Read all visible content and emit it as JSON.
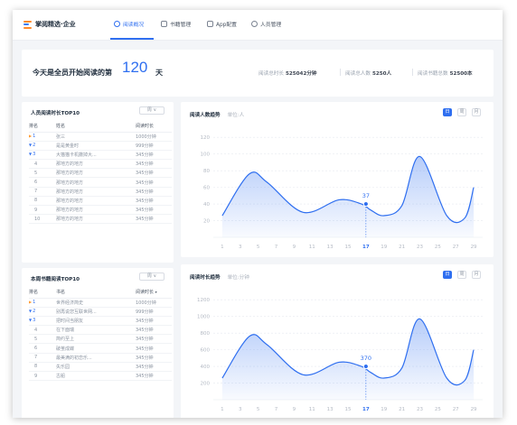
{
  "app": {
    "name": "掌阅精选·企业"
  },
  "nav": {
    "tabs": [
      {
        "label": "阅读概况"
      },
      {
        "label": "书籍管理"
      },
      {
        "label": "App配置"
      },
      {
        "label": "人员管理"
      }
    ]
  },
  "banner": {
    "lead": "今天是全员开始阅读的第",
    "days": "120",
    "unit": "天",
    "stats": [
      {
        "label": "阅读总时长",
        "value": "525042分钟"
      },
      {
        "label": "阅读总人数",
        "value": "5250人"
      },
      {
        "label": "阅读书籍总数",
        "value": "52500本"
      }
    ]
  },
  "people_top": {
    "title": "人员阅读时长TOP10",
    "filter": "周",
    "headers": [
      "排名",
      "姓名",
      "阅读时长"
    ],
    "rows": [
      {
        "rank": "1",
        "name": "张三",
        "value": "1000分钟",
        "trend": "up"
      },
      {
        "rank": "2",
        "name": "是是黄金时",
        "value": "999分钟",
        "trend": "down"
      },
      {
        "rank": "3",
        "name": "大猫猫卡机撒掉大...",
        "value": "345分钟",
        "trend": "down"
      },
      {
        "rank": "4",
        "name": "那地方的地方",
        "value": "345分钟",
        "trend": ""
      },
      {
        "rank": "5",
        "name": "那地方的地方",
        "value": "345分钟",
        "trend": ""
      },
      {
        "rank": "6",
        "name": "那地方的地方",
        "value": "345分钟",
        "trend": ""
      },
      {
        "rank": "7",
        "name": "那地方的地方",
        "value": "345分钟",
        "trend": ""
      },
      {
        "rank": "8",
        "name": "那地方的地方",
        "value": "345分钟",
        "trend": ""
      },
      {
        "rank": "9",
        "name": "那地方的地方",
        "value": "345分钟",
        "trend": ""
      },
      {
        "rank": "10",
        "name": "那地方的地方",
        "value": "345分钟",
        "trend": ""
      }
    ]
  },
  "books_top": {
    "title": "本周书籍阅读TOP10",
    "filter": "周",
    "headers": [
      "排名",
      "书名",
      "阅读时长"
    ],
    "rows": [
      {
        "rank": "1",
        "name": "世界经济简史",
        "value": "1000分钟",
        "trend": "up"
      },
      {
        "rank": "2",
        "name": "别再说您互联世网...",
        "value": "999分钟",
        "trend": "down"
      },
      {
        "rank": "3",
        "name": "把时间当朋友",
        "value": "345分钟",
        "trend": "down"
      },
      {
        "rank": "4",
        "name": "在下面瑞",
        "value": "345分钟",
        "trend": ""
      },
      {
        "rank": "5",
        "name": "简约至上",
        "value": "345分钟",
        "trend": ""
      },
      {
        "rank": "6",
        "name": "破茧成蝶",
        "value": "345分钟",
        "trend": ""
      },
      {
        "rank": "7",
        "name": "最美满的初恋乐...",
        "value": "345分钟",
        "trend": ""
      },
      {
        "rank": "8",
        "name": "失乐园",
        "value": "345分钟",
        "trend": ""
      },
      {
        "rank": "9",
        "name": "古船",
        "value": "345分钟",
        "trend": ""
      }
    ]
  },
  "charts_ui": {
    "people": {
      "title": "阅读人数趋势",
      "unit": "单位:人",
      "toggles": [
        "日",
        "周",
        "月"
      ]
    },
    "duration": {
      "title": "阅读时长趋势",
      "unit": "单位:分钟",
      "toggles": [
        "日",
        "周",
        "月"
      ]
    }
  },
  "chart_data": [
    {
      "type": "area",
      "title": "阅读人数趋势",
      "ylabel": "单位:人",
      "x": [
        1,
        3,
        5,
        7,
        9,
        11,
        13,
        15,
        17,
        19,
        21,
        23,
        25,
        27,
        29
      ],
      "yticks": [
        20,
        40,
        60,
        80,
        100,
        120
      ],
      "ylim": [
        0,
        130
      ],
      "highlight": {
        "x": 17,
        "label": "37"
      },
      "points": [
        [
          1,
          26
        ],
        [
          4,
          76
        ],
        [
          6,
          66
        ],
        [
          10,
          30
        ],
        [
          14,
          45
        ],
        [
          16.5,
          40
        ],
        [
          17.5,
          33
        ],
        [
          19,
          26
        ],
        [
          21,
          38
        ],
        [
          23,
          97
        ],
        [
          26,
          26
        ],
        [
          28,
          23
        ],
        [
          29,
          60
        ]
      ],
      "color": "#2f6ff0"
    },
    {
      "type": "area",
      "title": "阅读时长趋势",
      "ylabel": "单位:分钟",
      "x": [
        1,
        3,
        5,
        7,
        9,
        11,
        13,
        15,
        17,
        19,
        21,
        23,
        25,
        27,
        29
      ],
      "yticks": [
        200,
        400,
        600,
        800,
        1000,
        1200
      ],
      "ylim": [
        0,
        1300
      ],
      "highlight": {
        "x": 17,
        "label": "370"
      },
      "points": [
        [
          1,
          260
        ],
        [
          4,
          760
        ],
        [
          6,
          660
        ],
        [
          10,
          300
        ],
        [
          14,
          450
        ],
        [
          16.5,
          400
        ],
        [
          17.5,
          330
        ],
        [
          19,
          260
        ],
        [
          21,
          380
        ],
        [
          23,
          970
        ],
        [
          26,
          260
        ],
        [
          28,
          230
        ],
        [
          29,
          600
        ]
      ],
      "color": "#2f6ff0"
    }
  ]
}
